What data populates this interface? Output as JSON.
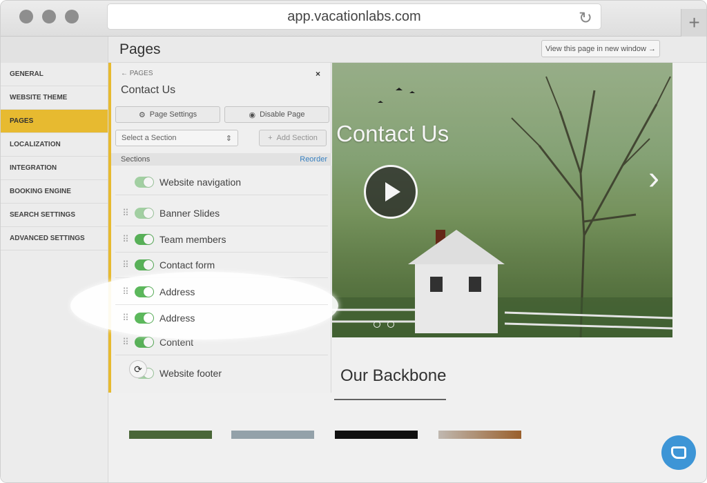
{
  "browser": {
    "url": "app.vacationlabs.com",
    "new_tab_label": "+"
  },
  "header": {
    "title": "Pages",
    "view_button": "View this page in new window →"
  },
  "sidebar": {
    "items": [
      {
        "label": "GENERAL"
      },
      {
        "label": "WEBSITE THEME"
      },
      {
        "label": "PAGES",
        "active": true
      },
      {
        "label": "LOCALIZATION"
      },
      {
        "label": "INTEGRATION"
      },
      {
        "label": "BOOKING ENGINE"
      },
      {
        "label": "SEARCH SETTINGS"
      },
      {
        "label": "ADVANCED SETTINGS"
      }
    ]
  },
  "panel": {
    "breadcrumb": "← PAGES",
    "close": "×",
    "title": "Contact Us",
    "page_settings": "Page Settings",
    "disable_page": "Disable Page",
    "select_placeholder": "Select a Section",
    "add_section": "Add Section",
    "sections_label": "Sections",
    "reorder_label": "Reorder",
    "sections": [
      {
        "label": "Website navigation",
        "enabled": true,
        "draggable": false
      },
      {
        "label": "Banner Slides",
        "enabled": true,
        "draggable": true
      },
      {
        "label": "Team members",
        "enabled": true,
        "draggable": true
      },
      {
        "label": "Contact form",
        "enabled": true,
        "draggable": true
      },
      {
        "label": "Address",
        "enabled": true,
        "draggable": true
      },
      {
        "label": "Address",
        "enabled": true,
        "draggable": true
      },
      {
        "label": "Content",
        "enabled": true,
        "draggable": true
      },
      {
        "label": "Website footer",
        "enabled": true,
        "draggable": false
      }
    ]
  },
  "preview": {
    "hero_title": "Contact Us",
    "section_heading": "Our Backbone"
  },
  "colors": {
    "accent": "#f1c232",
    "toggle_on": "#5cb85c",
    "link": "#3a86c8",
    "chat": "#3d95d6"
  }
}
